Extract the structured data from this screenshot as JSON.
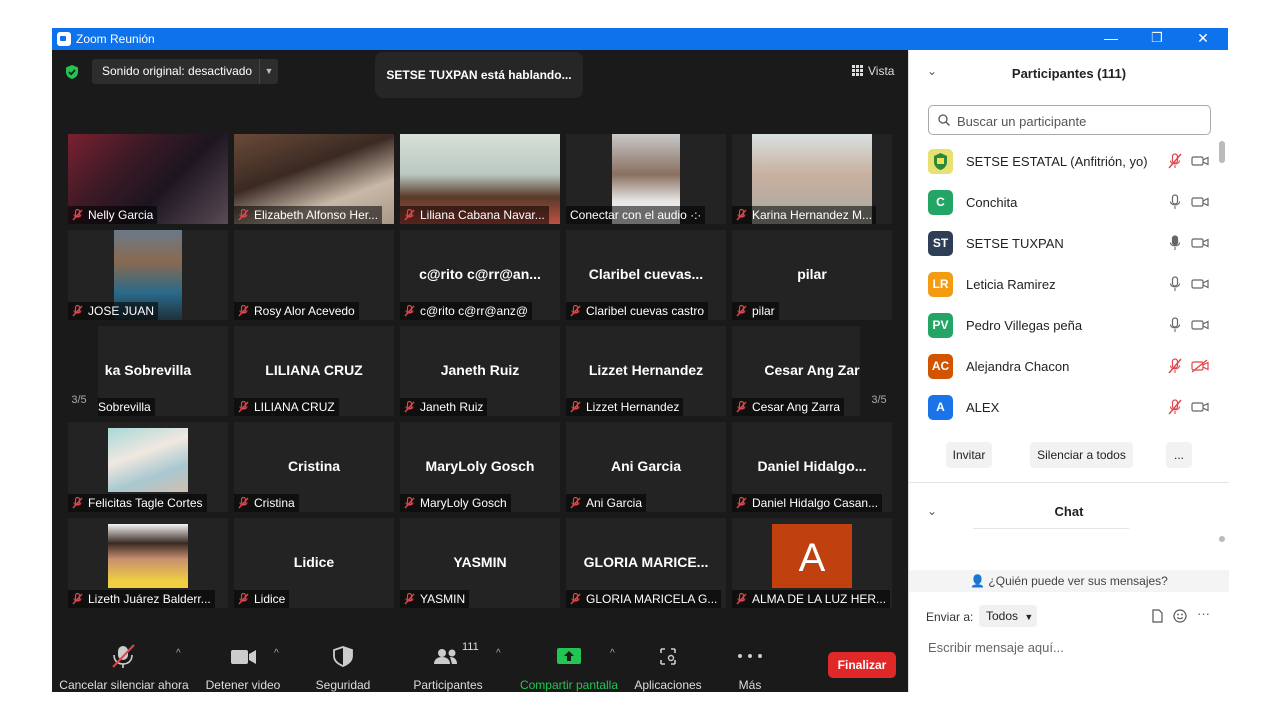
{
  "window": {
    "title": "Zoom Reunión",
    "minimize_glyph": "—",
    "restore_glyph": "❐",
    "close_glyph": "✕"
  },
  "topbar": {
    "audio_label": "Sonido original: desactivado",
    "speaking": "SETSE TUXPAN está hablando...",
    "view_label": "Vista"
  },
  "nav": {
    "left_page": "3/5",
    "right_page": "3/5"
  },
  "tiles": [
    {
      "big": "",
      "label": "Nelly Garcia",
      "photo": "nelly"
    },
    {
      "big": "",
      "label": "Elizabeth Alfonso Her...",
      "photo": "elizabeth"
    },
    {
      "big": "",
      "label": "Liliana Cabana Navar...",
      "photo": "liliana"
    },
    {
      "big": "",
      "label": "Conectar con el audio ·:·",
      "photo": "conectar"
    },
    {
      "big": "",
      "label": "Karina Hernandez M...",
      "photo": "karina"
    },
    {
      "big": "",
      "label": "JOSE JUAN",
      "photo": "jose"
    },
    {
      "big": "",
      "label": "Rosy Alor Acevedo",
      "photo": ""
    },
    {
      "big": "c@rito  c@rr@an...",
      "label": "c@rito c@rr@anz@",
      "photo": ""
    },
    {
      "big": "Claribel  cuevas...",
      "label": "Claribel cuevas castro",
      "photo": ""
    },
    {
      "big": "pilar",
      "label": "pilar",
      "photo": ""
    },
    {
      "big": "ka Sobrevilla",
      "label": "a Sobrevilla",
      "photo": ""
    },
    {
      "big": "LILIANA CRUZ",
      "label": "LILIANA CRUZ",
      "photo": ""
    },
    {
      "big": "Janeth Ruiz",
      "label": "Janeth Ruiz",
      "photo": ""
    },
    {
      "big": "Lizzet Hernandez",
      "label": "Lizzet Hernandez",
      "photo": ""
    },
    {
      "big": "Cesar  Ang Zar",
      "label": "Cesar Ang Zarra",
      "photo": ""
    },
    {
      "big": "",
      "label": "Felicitas Tagle Cortes",
      "photo": "felicitas"
    },
    {
      "big": "Cristina",
      "label": "Cristina",
      "photo": ""
    },
    {
      "big": "MaryLoly Gosch",
      "label": "MaryLoly Gosch",
      "photo": ""
    },
    {
      "big": "Ani Garcia",
      "label": "Ani Garcia",
      "photo": ""
    },
    {
      "big": "Daniel  Hidalgo...",
      "label": "Daniel Hidalgo Casan...",
      "photo": ""
    },
    {
      "big": "",
      "label": "Lizeth Juárez Balderr...",
      "photo": "lizeth"
    },
    {
      "big": "Lidice",
      "label": "Lidice",
      "photo": ""
    },
    {
      "big": "YASMIN",
      "label": "YASMIN",
      "photo": ""
    },
    {
      "big": "GLORIA  MARICE...",
      "label": "GLORIA MARICELA G...",
      "photo": ""
    },
    {
      "big": "",
      "label": "ALMA DE LA LUZ HER...",
      "photo": "alma"
    }
  ],
  "alma_letter": "A",
  "toolbar": {
    "unmute": "Cancelar silenciar ahora",
    "video": "Detener video",
    "security": "Seguridad",
    "participants": "Participantes",
    "participants_count": "111",
    "share": "Compartir pantalla",
    "apps": "Aplicaciones",
    "more": "Más",
    "end": "Finalizar",
    "caret": "^"
  },
  "panel": {
    "title": "Participantes (111)",
    "search_placeholder": "Buscar un participante",
    "participants": [
      {
        "initials": "",
        "name": "SETSE ESTATAL (Anfitrión, yo)",
        "color": "#e8e070",
        "mic": "muted",
        "cam": "off"
      },
      {
        "initials": "C",
        "name": "Conchita",
        "color": "#23a566",
        "mic": "on",
        "cam": "off"
      },
      {
        "initials": "ST",
        "name": "SETSE TUXPAN",
        "color": "#2d3e55",
        "mic": "active",
        "cam": "off"
      },
      {
        "initials": "LR",
        "name": "Leticia Ramirez",
        "color": "#f39c12",
        "mic": "on",
        "cam": "off"
      },
      {
        "initials": "PV",
        "name": "Pedro Villegas peña",
        "color": "#23a566",
        "mic": "on",
        "cam": "off"
      },
      {
        "initials": "AC",
        "name": "Alejandra Chacon",
        "color": "#d35400",
        "mic": "muted",
        "cam": "muted"
      },
      {
        "initials": "A",
        "name": "ALEX",
        "color": "#1a73e8",
        "mic": "muted",
        "cam": "off"
      }
    ],
    "invite": "Invitar",
    "mute_all": "Silenciar a todos",
    "more": "...",
    "chat_title": "Chat",
    "who_can_see": "¿Quién puede ver sus mensajes?",
    "send_to": "Enviar a:",
    "send_to_value": "Todos",
    "message_placeholder": "Escribir mensaje aquí...",
    "more_dots": "···"
  },
  "colors": {
    "title_bar": "#0e72ed",
    "end_button": "#e02828",
    "share_green": "#23c552",
    "muted_red": "#e0454a"
  }
}
